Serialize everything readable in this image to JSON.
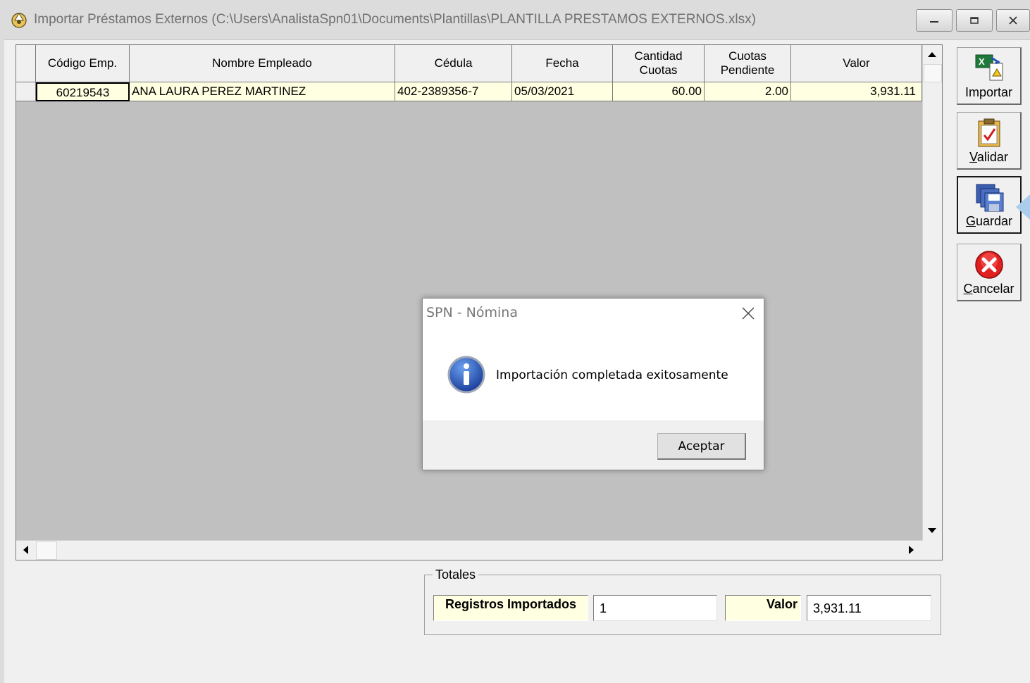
{
  "window": {
    "title": "Importar Préstamos Externos (C:\\Users\\AnalistaSpn01\\Documents\\Plantillas\\PLANTILLA PRESTAMOS EXTERNOS.xlsx)",
    "min_icon": "minimize-icon",
    "max_icon": "restore-icon",
    "close_icon": "close-icon"
  },
  "grid": {
    "columns": [
      "Código Emp.",
      "Nombre Empleado",
      "Cédula",
      "Fecha",
      "Cantidad Cuotas",
      "Cuotas Pendiente",
      "Valor"
    ],
    "rows": [
      {
        "codigo": "60219543",
        "nombre": "ANA LAURA PEREZ MARTINEZ",
        "cedula": "402-2389356-7",
        "fecha": "05/03/2021",
        "cantidad_cuotas": "60.00",
        "cuotas_pendiente": "2.00",
        "valor": "3,931.11"
      }
    ],
    "row_bg": "#ffffe1",
    "empty_bg": "#c0c0c0"
  },
  "side_buttons": {
    "importar": {
      "label": "Importar",
      "icon": "excel-import-icon"
    },
    "validar": {
      "label": "Validar",
      "icon": "clipboard-check-icon"
    },
    "guardar": {
      "label": "Guardar",
      "icon": "save-disks-icon"
    },
    "cancelar": {
      "label": "Cancelar",
      "icon": "cancel-x-icon"
    }
  },
  "totales": {
    "legend": "Totales",
    "registros_label": "Registros Importados",
    "registros_value": "1",
    "valor_label": "Valor",
    "valor_value": "3,931.11"
  },
  "dialog": {
    "title": "SPN - Nómina",
    "message": "Importación completada exitosamente",
    "ok_label": "Aceptar",
    "icon": "info-icon"
  }
}
